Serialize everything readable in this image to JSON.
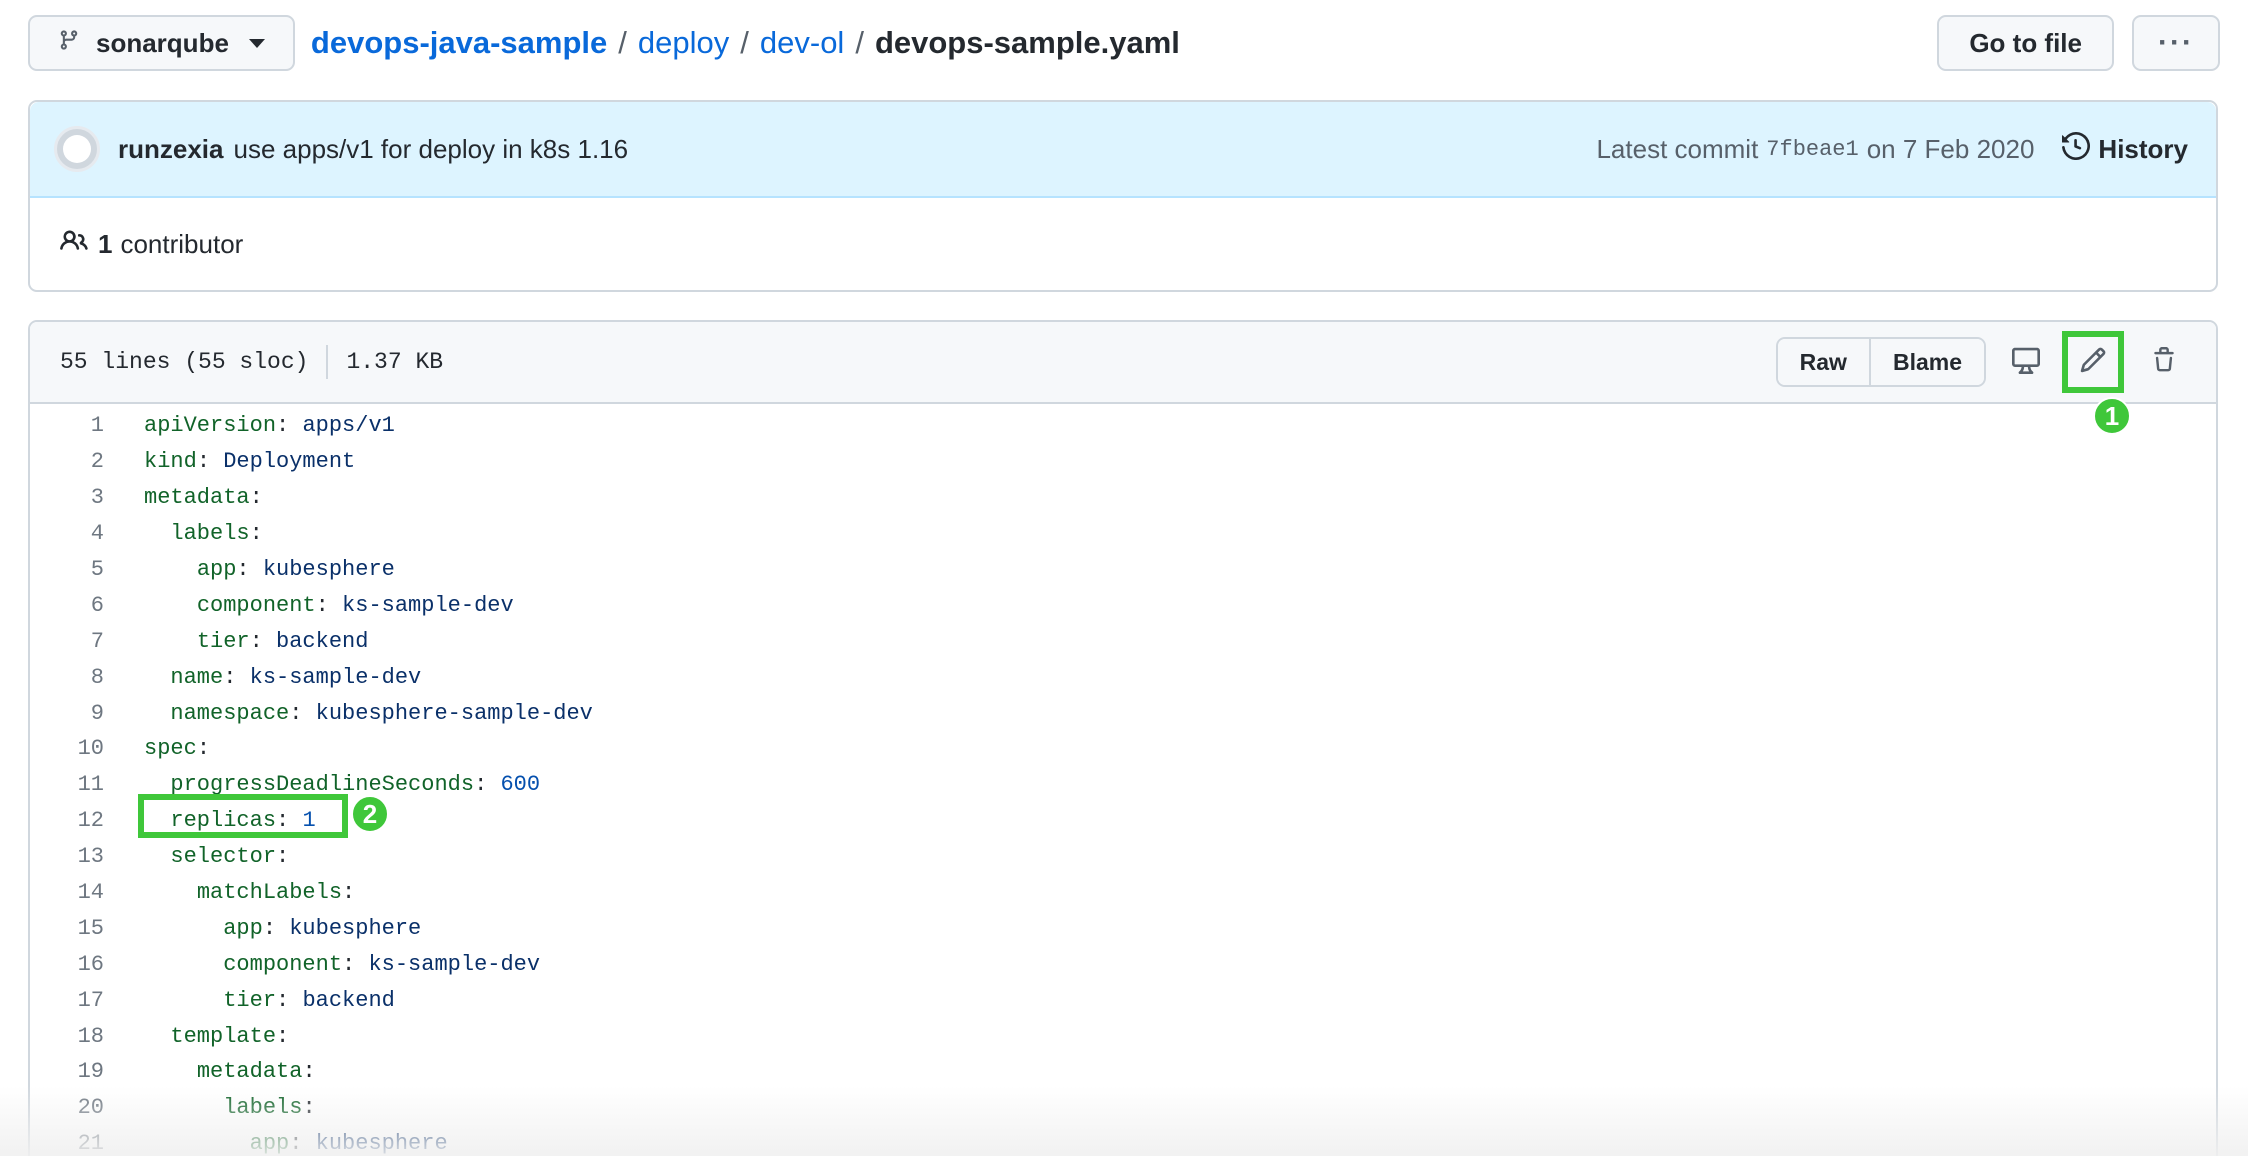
{
  "header": {
    "branch": "sonarqube",
    "breadcrumb": {
      "repo": "devops-java-sample",
      "sep1": "/",
      "dir1": "deploy",
      "sep2": "/",
      "dir2": "dev-ol",
      "sep3": "/",
      "file": "devops-sample.yaml"
    },
    "go_to_file": "Go to file",
    "more": "···"
  },
  "commit": {
    "author": "runzexia",
    "message": "use apps/v1 for deploy in k8s 1.16",
    "latest_label": "Latest commit",
    "sha": "7fbeae1",
    "date": "on 7 Feb 2020",
    "history": "History"
  },
  "contributors": {
    "count": "1",
    "label": "contributor"
  },
  "file": {
    "lines_info": "55 lines (55 sloc)",
    "size": "1.37 KB",
    "raw": "Raw",
    "blame": "Blame"
  },
  "annotations": {
    "badge1": "1",
    "badge2": "2",
    "color": "#3fc73a"
  },
  "code_lines": [
    {
      "n": "1",
      "indent": "",
      "key": "apiVersion",
      "val": "apps/v1",
      "type": "str"
    },
    {
      "n": "2",
      "indent": "",
      "key": "kind",
      "val": "Deployment",
      "type": "str"
    },
    {
      "n": "3",
      "indent": "",
      "key": "metadata",
      "val": "",
      "type": "str"
    },
    {
      "n": "4",
      "indent": "  ",
      "key": "labels",
      "val": "",
      "type": "str"
    },
    {
      "n": "5",
      "indent": "    ",
      "key": "app",
      "val": "kubesphere",
      "type": "str"
    },
    {
      "n": "6",
      "indent": "    ",
      "key": "component",
      "val": "ks-sample-dev",
      "type": "str"
    },
    {
      "n": "7",
      "indent": "    ",
      "key": "tier",
      "val": "backend",
      "type": "str"
    },
    {
      "n": "8",
      "indent": "  ",
      "key": "name",
      "val": "ks-sample-dev",
      "type": "str"
    },
    {
      "n": "9",
      "indent": "  ",
      "key": "namespace",
      "val": "kubesphere-sample-dev",
      "type": "str"
    },
    {
      "n": "10",
      "indent": "",
      "key": "spec",
      "val": "",
      "type": "str"
    },
    {
      "n": "11",
      "indent": "  ",
      "key": "progressDeadlineSeconds",
      "val": "600",
      "type": "num"
    },
    {
      "n": "12",
      "indent": "  ",
      "key": "replicas",
      "val": "1",
      "type": "num"
    },
    {
      "n": "13",
      "indent": "  ",
      "key": "selector",
      "val": "",
      "type": "str"
    },
    {
      "n": "14",
      "indent": "    ",
      "key": "matchLabels",
      "val": "",
      "type": "str"
    },
    {
      "n": "15",
      "indent": "      ",
      "key": "app",
      "val": "kubesphere",
      "type": "str"
    },
    {
      "n": "16",
      "indent": "      ",
      "key": "component",
      "val": "ks-sample-dev",
      "type": "str"
    },
    {
      "n": "17",
      "indent": "      ",
      "key": "tier",
      "val": "backend",
      "type": "str"
    },
    {
      "n": "18",
      "indent": "  ",
      "key": "template",
      "val": "",
      "type": "str"
    },
    {
      "n": "19",
      "indent": "    ",
      "key": "metadata",
      "val": "",
      "type": "str"
    },
    {
      "n": "20",
      "indent": "      ",
      "key": "labels",
      "val": "",
      "type": "str"
    },
    {
      "n": "21",
      "indent": "        ",
      "key": "app",
      "val": "kubesphere",
      "type": "str"
    }
  ]
}
